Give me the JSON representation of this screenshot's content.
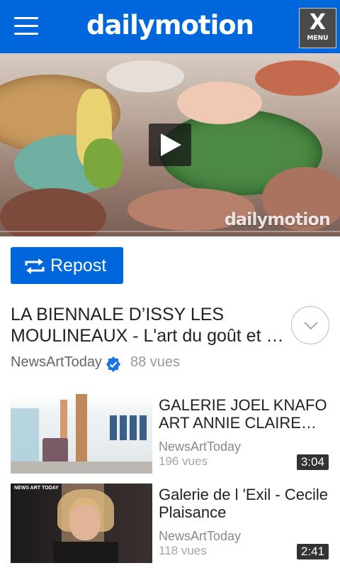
{
  "header": {
    "logo": "dailymotion",
    "menu_x": "X",
    "menu_label": "MENU"
  },
  "player": {
    "watermark": "dailymotion",
    "progress_fraction": 0.0
  },
  "repost": {
    "label": "Repost"
  },
  "video": {
    "title": "LA BIENNALE D’ISSY LES MOULINEAUX - L'art du goût et du goût de l'art",
    "channel": "NewsArtToday",
    "views": "88 vues"
  },
  "related": [
    {
      "title": "GALERIE JOEL KNAFO ART ANNIE CLAIRE ALVOET",
      "channel": "NewsArtToday",
      "views": "196 vues",
      "duration": "3:04"
    },
    {
      "title": "Galerie de l 'Exil - Cecile Plaisance",
      "channel": "NewsArtToday",
      "views": "118 vues",
      "duration": "2:41",
      "thumb_overlay": "NEWS ART TODAY"
    }
  ],
  "colors": {
    "brand_blue": "#0066dc",
    "verified": "#1a73e8"
  },
  "icons": {
    "menu": "hamburger-icon",
    "play": "play-icon",
    "repost": "repost-icon",
    "expand": "chevron-down-icon",
    "verified": "verified-badge-icon"
  }
}
